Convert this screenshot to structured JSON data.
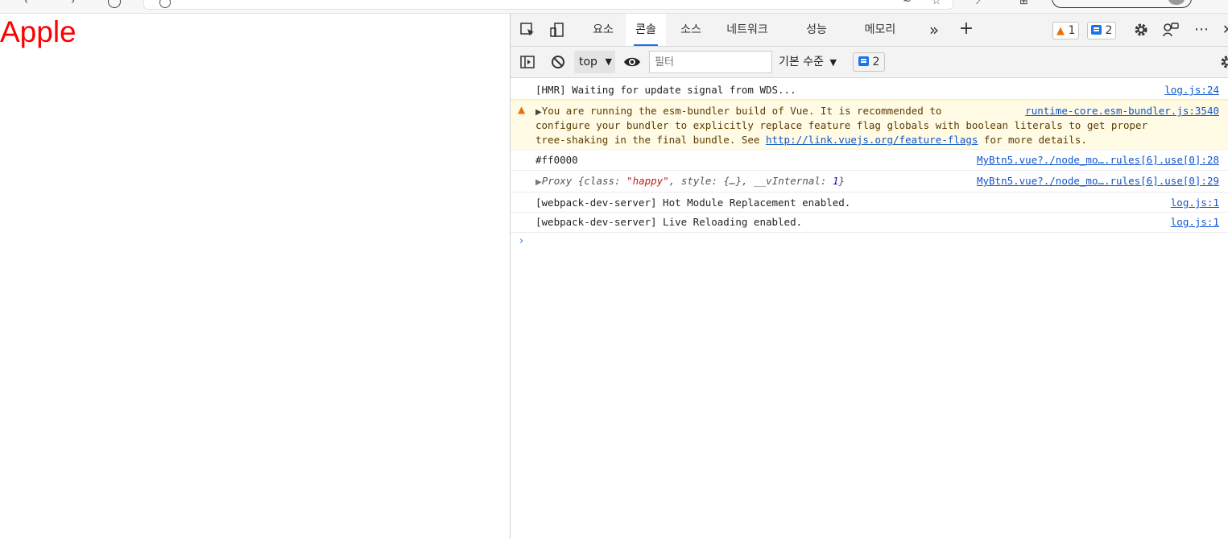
{
  "page": {
    "heading": "Apple"
  },
  "devtools": {
    "tabs": [
      {
        "label": "요소"
      },
      {
        "label": "콘솔"
      },
      {
        "label": "소스"
      },
      {
        "label": "네트워크"
      },
      {
        "label": "성능"
      },
      {
        "label": "메모리"
      }
    ],
    "more_tabs_glyph": "»",
    "add_tab_glyph": "+",
    "warnings_count": "1",
    "messages_count": "2",
    "more_glyph": "⋯"
  },
  "toolbar": {
    "context": "top",
    "filter_placeholder": "필터",
    "level": "기본 수준",
    "issues_count": "2"
  },
  "console": {
    "rows": [
      {
        "text": "[HMR] Waiting for update signal from WDS...",
        "source": "log.js:24"
      },
      {
        "text_line1": "You are running the esm-bundler build of Vue. It is recommended to",
        "text_line2": "configure your bundler to explicitly replace feature flag globals with boolean literals to get proper",
        "text_line3_pre": "tree-shaking in the final bundle. See ",
        "link": "http://link.vuejs.org/feature-flags",
        "text_line3_post": " for more details.",
        "source": "runtime-core.esm-bundler.js:3540"
      },
      {
        "text": "#ff0000",
        "source": "MyBtn5.vue?./node_mo….rules[6].use[0]:28"
      },
      {
        "proxy_label": "Proxy",
        "proxy_open": " {class: ",
        "proxy_class": "\"happy\"",
        "proxy_mid": ", style: {…}, __vInternal: ",
        "proxy_num": "1",
        "proxy_close": "}",
        "source": "MyBtn5.vue?./node_mo….rules[6].use[0]:29"
      },
      {
        "text": "[webpack-dev-server] Hot Module Replacement enabled.",
        "source": "log.js:1"
      },
      {
        "text": "[webpack-dev-server] Live Reloading enabled.",
        "source": "log.js:1"
      }
    ],
    "prompt": "›"
  },
  "colors": {
    "heading": "#ff0000",
    "accent": "#1a73e8",
    "warning": "#e8710a"
  }
}
